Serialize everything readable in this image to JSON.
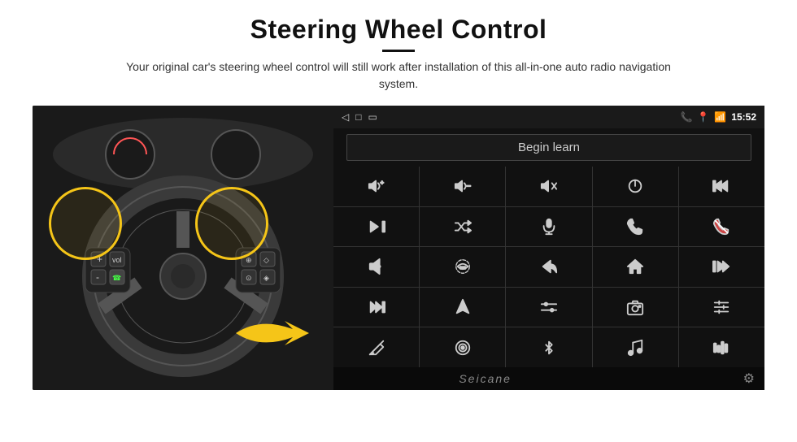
{
  "header": {
    "title": "Steering Wheel Control",
    "subtitle": "Your original car's steering wheel control will still work after installation of this all-in-one auto radio navigation system."
  },
  "status_bar": {
    "time": "15:52",
    "nav_back": "◁",
    "nav_home": "□",
    "nav_recent": "▭"
  },
  "begin_learn": {
    "label": "Begin learn"
  },
  "brand": {
    "name": "Seicane"
  },
  "icon_grid": [
    {
      "id": "vol-up",
      "symbol": "🔊+"
    },
    {
      "id": "vol-down",
      "symbol": "🔉-"
    },
    {
      "id": "mute",
      "symbol": "🔇"
    },
    {
      "id": "power",
      "symbol": "⏻"
    },
    {
      "id": "prev-track",
      "symbol": "⏮"
    },
    {
      "id": "skip-next",
      "symbol": "⏭"
    },
    {
      "id": "shuffle",
      "symbol": "⇌⏭"
    },
    {
      "id": "mic",
      "symbol": "🎤"
    },
    {
      "id": "phone",
      "symbol": "📞"
    },
    {
      "id": "hang-up",
      "symbol": "📵"
    },
    {
      "id": "speaker",
      "symbol": "📢"
    },
    {
      "id": "360",
      "symbol": "360°"
    },
    {
      "id": "back",
      "symbol": "↩"
    },
    {
      "id": "home",
      "symbol": "⌂"
    },
    {
      "id": "skip-bk",
      "symbol": "⏮⏮"
    },
    {
      "id": "fast-fwd",
      "symbol": "⏭⏭"
    },
    {
      "id": "nav",
      "symbol": "▶"
    },
    {
      "id": "eq",
      "symbol": "⇌"
    },
    {
      "id": "camera",
      "symbol": "📷"
    },
    {
      "id": "settings",
      "symbol": "⚙"
    },
    {
      "id": "pen",
      "symbol": "✎"
    },
    {
      "id": "target",
      "symbol": "🎯"
    },
    {
      "id": "bt",
      "symbol": "⚡"
    },
    {
      "id": "music",
      "symbol": "♫"
    },
    {
      "id": "waves",
      "symbol": "📶"
    }
  ]
}
